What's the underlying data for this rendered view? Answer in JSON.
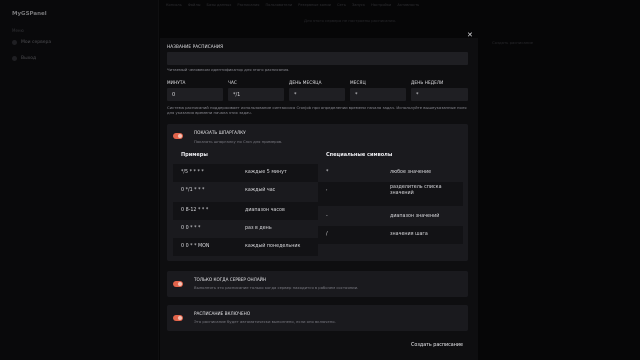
{
  "app": {
    "title": "MyGSPanel"
  },
  "sidebar": {
    "section": "Меню",
    "items": [
      {
        "label": "Мои сервера"
      },
      {
        "label": "Выход"
      }
    ]
  },
  "topnav": {
    "items": [
      "Консоль",
      "Файлы",
      "Базы данных",
      "Расписания",
      "Пользователи",
      "Резервные копии",
      "Сеть",
      "Запуск",
      "Настройки",
      "Активность"
    ]
  },
  "background": {
    "notice": "Для этого сервера не настроены расписания.",
    "create_btn": "Создать расписание"
  },
  "modal": {
    "name_label": "Название расписания",
    "name_value": "",
    "name_hint": "Читаемый человеком идентификатор для этого расписания.",
    "cron": [
      {
        "label": "Минута",
        "value": "0"
      },
      {
        "label": "Час",
        "value": "*/1"
      },
      {
        "label": "День месяца",
        "value": "*"
      },
      {
        "label": "Месяц",
        "value": "*"
      },
      {
        "label": "День недели",
        "value": "*"
      }
    ],
    "cron_hint": "Система расписаний поддерживает использование синтаксиса Cronjob при определении времени начала задач. Используйте вышеуказанные поля для указания времени начала этих задач.",
    "cheatsheet": {
      "title": "Показать шпаргалку",
      "desc": "Показать шпаргалку по Cron для примеров.",
      "examples_header": "Примеры",
      "special_header": "Специальные символы",
      "examples": [
        {
          "expr": "*/5 * * * *",
          "desc": "каждые 5 минут"
        },
        {
          "expr": "0 */1 * * *",
          "desc": "каждый час"
        },
        {
          "expr": "0 8-12 * * *",
          "desc": "диапазон часов"
        },
        {
          "expr": "0 0 * * *",
          "desc": "раз в день"
        },
        {
          "expr": "0 0 * * MON",
          "desc": "каждый понедельник"
        }
      ],
      "specials": [
        {
          "sym": "*",
          "desc": "любое значение"
        },
        {
          "sym": ",",
          "desc": "разделитель списка значений"
        },
        {
          "sym": "-",
          "desc": "диапазон значений"
        },
        {
          "sym": "/",
          "desc": "значения шага"
        }
      ]
    },
    "online_only": {
      "title": "Только когда сервер онлайн",
      "desc": "Выполнять это расписание только когда сервер находится в рабочем состоянии."
    },
    "enabled": {
      "title": "Расписание включено",
      "desc": "Это расписание будет автоматически выполнено, если оно включено."
    },
    "submit": "Создать расписание",
    "close_icon": "close-icon",
    "accent": "#e2644b"
  }
}
